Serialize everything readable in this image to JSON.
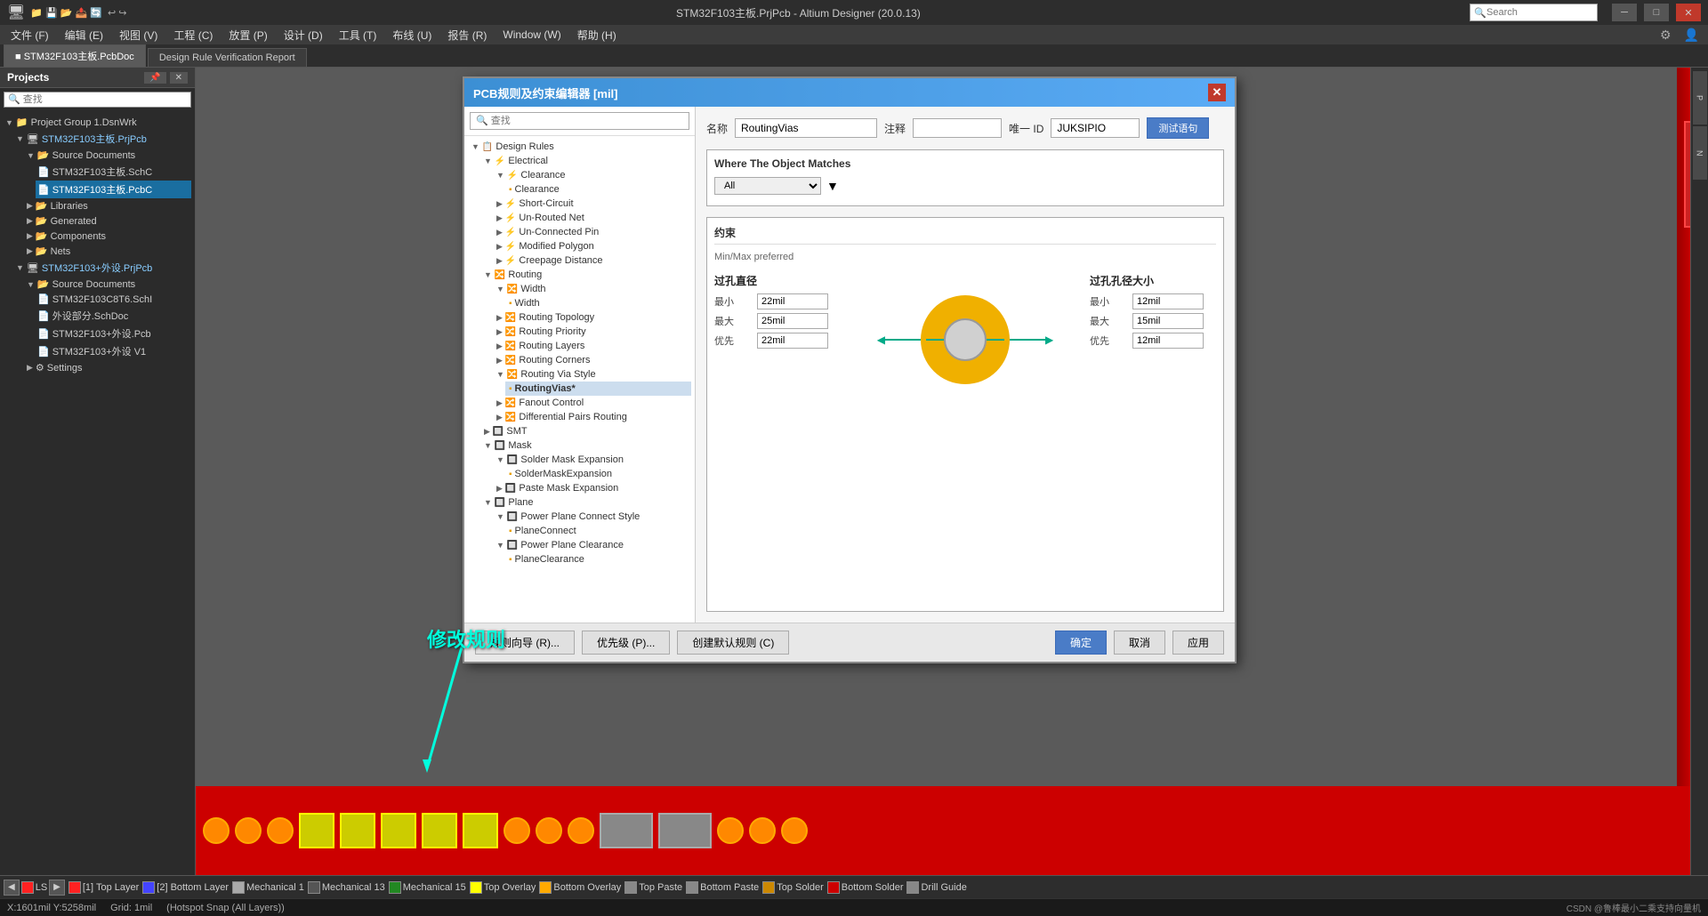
{
  "window": {
    "title": "STM32F103主板.PrjPcb - Altium Designer (20.0.13)",
    "close_label": "✕",
    "minimize_label": "─",
    "maximize_label": "□"
  },
  "search": {
    "placeholder": "Search"
  },
  "menu": {
    "items": [
      {
        "label": "文件 (F)"
      },
      {
        "label": "编辑 (E)"
      },
      {
        "label": "视图 (V)"
      },
      {
        "label": "工程 (C)"
      },
      {
        "label": "放置 (P)"
      },
      {
        "label": "设计 (D)"
      },
      {
        "label": "工具 (T)"
      },
      {
        "label": "布线 (U)"
      },
      {
        "label": "报告 (R)"
      },
      {
        "label": "Window (W)"
      },
      {
        "label": "帮助 (H)"
      }
    ]
  },
  "tabs": [
    {
      "label": "■ STM32F103主板.PcbDoc"
    },
    {
      "label": "Design Rule Verification Report"
    }
  ],
  "left_panel": {
    "title": "Projects",
    "search_placeholder": "🔍 查找",
    "tree": [
      {
        "label": "Project Group 1.DsnWrk",
        "level": 0
      },
      {
        "label": "STM32F103主板.PrjPcb",
        "level": 1
      },
      {
        "label": "Source Documents",
        "level": 2
      },
      {
        "label": "STM32F103主板.SchC",
        "level": 3
      },
      {
        "label": "STM32F103主板.PcbC",
        "level": 3,
        "selected": true
      },
      {
        "label": "Libraries",
        "level": 2
      },
      {
        "label": "Generated",
        "level": 2
      },
      {
        "label": "Components",
        "level": 2
      },
      {
        "label": "Nets",
        "level": 2
      },
      {
        "label": "STM32F103+外设.PrjPcb",
        "level": 1
      },
      {
        "label": "Source Documents",
        "level": 2
      },
      {
        "label": "STM32F103C8T6.SchI",
        "level": 3
      },
      {
        "label": "外设部分.SchDoc",
        "level": 3
      },
      {
        "label": "STM32F103+外设.Pcb",
        "level": 3
      },
      {
        "label": "STM32F103+外设 V1",
        "level": 3
      },
      {
        "label": "Settings",
        "level": 2
      }
    ]
  },
  "dialog": {
    "title": "PCB规则及约束编辑器 [mil]",
    "close_label": "✕",
    "search_placeholder": "🔍 查找",
    "tree": [
      {
        "label": "Design Rules",
        "level": 0
      },
      {
        "label": "Electrical",
        "level": 1
      },
      {
        "label": "Clearance",
        "level": 2
      },
      {
        "label": "Clearance",
        "level": 3
      },
      {
        "label": "Short-Circuit",
        "level": 2
      },
      {
        "label": "Un-Routed Net",
        "level": 2
      },
      {
        "label": "Un-Connected Pin",
        "level": 2
      },
      {
        "label": "Modified Polygon",
        "level": 2
      },
      {
        "label": "Creepage Distance",
        "level": 2
      },
      {
        "label": "Routing",
        "level": 1
      },
      {
        "label": "Width",
        "level": 2
      },
      {
        "label": "Width",
        "level": 3
      },
      {
        "label": "Routing Topology",
        "level": 2
      },
      {
        "label": "Routing Priority",
        "level": 2
      },
      {
        "label": "Routing Layers",
        "level": 2
      },
      {
        "label": "Routing Corners",
        "level": 2
      },
      {
        "label": "Routing Via Style",
        "level": 2
      },
      {
        "label": "RoutingVias*",
        "level": 3,
        "selected": true
      },
      {
        "label": "Fanout Control",
        "level": 2
      },
      {
        "label": "Differential Pairs Routing",
        "level": 2
      },
      {
        "label": "SMT",
        "level": 1
      },
      {
        "label": "Mask",
        "level": 1
      },
      {
        "label": "Solder Mask Expansion",
        "level": 2
      },
      {
        "label": "SolderMaskExpansion",
        "level": 3
      },
      {
        "label": "Paste Mask Expansion",
        "level": 2
      },
      {
        "label": "Plane",
        "level": 1
      },
      {
        "label": "Power Plane Connect Style",
        "level": 2
      },
      {
        "label": "PlaneConnect",
        "level": 3
      },
      {
        "label": "Power Plane Clearance",
        "level": 2
      },
      {
        "label": "PlaneClearance",
        "level": 3
      }
    ],
    "rule_name_label": "名称",
    "rule_name_value": "RoutingVias",
    "comment_label": "注释",
    "unique_id_label": "唯一 ID",
    "unique_id_value": "JUKSIPIO",
    "test_query_label": "测试语句",
    "where_title": "Where The Object Matches",
    "where_option": "All",
    "constraint_title": "约束",
    "constraint_sub": "Min/Max preferred",
    "via_diameter_label": "过孔直径",
    "min_label": "最小",
    "max_label": "最大",
    "preferred_label": "优先",
    "via_min": "22mil",
    "via_max": "25mil",
    "via_preferred": "22mil",
    "hole_size_label": "过孔孔径大小",
    "hole_min": "12mil",
    "hole_max": "15mil",
    "hole_preferred": "12mil",
    "annotation_text": "修改规则",
    "footer": {
      "rule_wizard": "规则向导 (R)...",
      "priority": "优先级 (P)...",
      "create_default": "创建默认规则 (C)",
      "ok": "确定",
      "cancel": "取消",
      "apply": "应用"
    }
  },
  "bottom_bar": {
    "layers": [
      {
        "color": "#ff2222",
        "label": "LS"
      },
      {
        "color": "#ff2222",
        "label": "[1] Top Layer"
      },
      {
        "color": "#4444ff",
        "label": "[2] Bottom Layer"
      },
      {
        "color": "#aaaaaa",
        "label": "Mechanical 1"
      },
      {
        "color": "#555555",
        "label": "Mechanical 13"
      },
      {
        "color": "#228822",
        "label": "Mechanical 15"
      },
      {
        "color": "#ffff00",
        "label": "Top Overlay"
      },
      {
        "color": "#ffaa00",
        "label": "Bottom Overlay"
      },
      {
        "color": "#888888",
        "label": "Top Paste"
      },
      {
        "color": "#888888",
        "label": "Bottom Paste"
      },
      {
        "color": "#cc8800",
        "label": "Top Solder"
      },
      {
        "color": "#cc0000",
        "label": "Bottom Solder"
      },
      {
        "color": "#888888",
        "label": "Drill Guide"
      }
    ]
  },
  "status_bar": {
    "coordinates": "X:1601mil Y:5258mil",
    "grid": "Grid: 1mil",
    "snap": "(Hotspot Snap (All Layers))",
    "csdn": "CSDN @鲁棒最小二乘支持向量机"
  }
}
